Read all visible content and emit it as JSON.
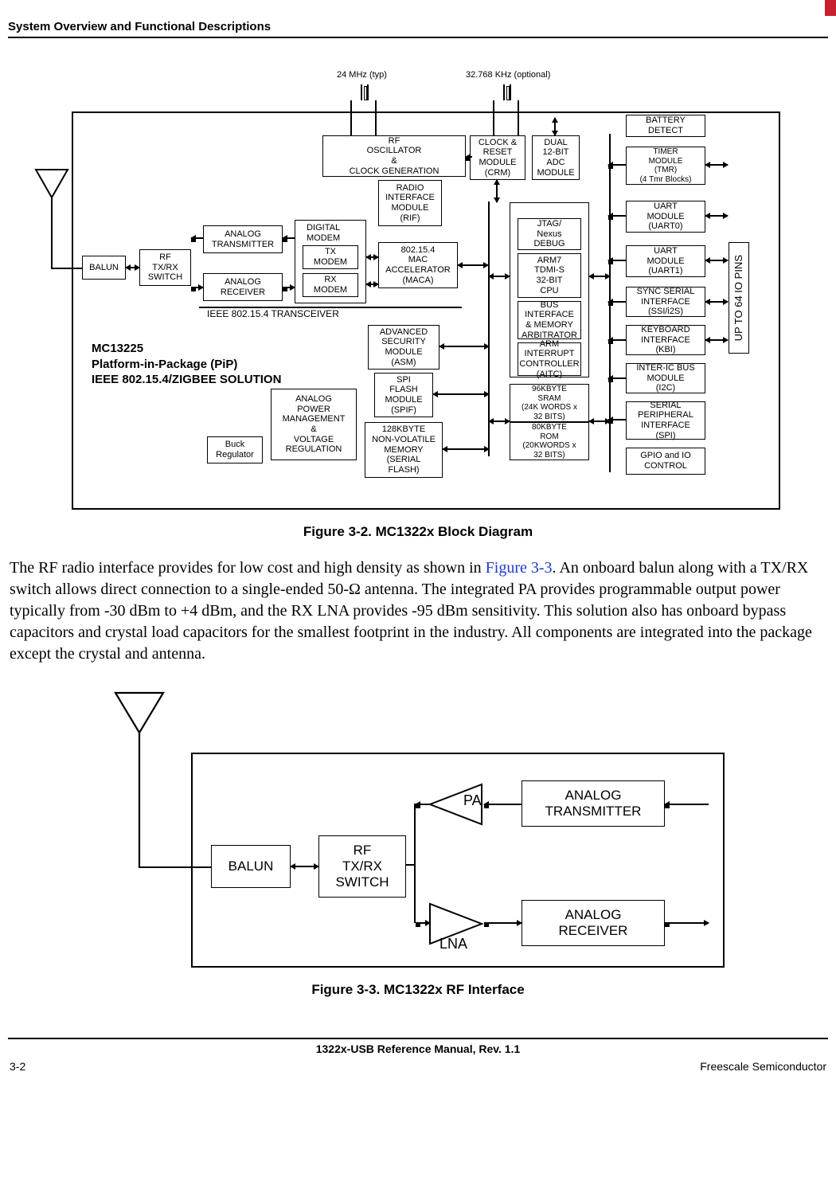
{
  "header": {
    "section_title": "System Overview and Functional Descriptions"
  },
  "fig1": {
    "clk24": "24 MHz (typ)",
    "clk32": "32.768 KHz (optional)",
    "rf_osc": "RF\nOSCILLATOR\n&\nCLOCK GENERATION",
    "rif": "RADIO\nINTERFACE\nMODULE\n(RIF)",
    "digital_modem": "DIGITAL\nMODEM",
    "tx_modem": "TX\nMODEM",
    "rx_modem": "RX\nMODEM",
    "maca": "802.15.4\nMAC\nACCELERATOR\n(MACA)",
    "analog_tx": "ANALOG\nTRANSMITTER",
    "analog_rx": "ANALOG\nRECEIVER",
    "balun": "BALUN",
    "rf_sw": "RF\nTX/RX\nSWITCH",
    "transceiver": "IEEE 802.15.4 TRANSCEIVER",
    "asm": "ADVANCED\nSECURITY\nMODULE\n(ASM)",
    "spif": "SPI\nFLASH\nMODULE\n(SPIF)",
    "flash": "128KBYTE\nNON-VOLATILE\nMEMORY\n(SERIAL\nFLASH)",
    "apm": "ANALOG\nPOWER\nMANAGEMENT\n&\nVOLTAGE\nREGULATION",
    "buck": "Buck\nRegulator",
    "crm": "CLOCK &\nRESET\nMODULE\n(CRM)",
    "adc": "DUAL\n12-BIT\nADC\nMODULE",
    "jtag": "JTAG/\nNexus\nDEBUG",
    "arm7": "ARM7\nTDMI-S\n32-BIT\nCPU",
    "bus": "BUS\nINTERFACE\n& MEMORY\nARBITRATOR",
    "aitc": "ARM\nINTERRUPT\nCONTROLLER\n(AITC)",
    "sram": "96KBYTE\nSRAM\n(24K WORDS x\n32 BITS)",
    "rom": "80KBYTE\nROM\n(20KWORDS x\n32 BITS)",
    "batt": "BATTERY\nDETECT",
    "tmr": "TIMER\nMODULE\n(TMR)\n(4 Tmr Blocks)",
    "uart0": "UART\nMODULE\n(UART0)",
    "uart1": "UART\nMODULE\n(UART1)",
    "ssi": "SYNC SERIAL\nINTERFACE\n(SSI/i2S)",
    "kbi": "KEYBOARD\nINTERFACE\n(KBI)",
    "i2c": "INTER-IC BUS\nMODULE\n(I2C)",
    "spi": "SERIAL\nPERIPHERAL\nINTERFACE\n(SPI)",
    "gpio": "GPIO and IO\nCONTROL",
    "iopins": "UP TO 64 IO PINS",
    "chip_label": "MC13225\nPlatform-in-Package (PiP)\nIEEE 802.15.4/ZIGBEE SOLUTION",
    "caption": "Figure 3-2. MC1322x Block Diagram"
  },
  "paragraph": {
    "pre": "The RF radio interface provides for low cost and high density as shown in ",
    "link": "Figure 3-3",
    "post": ". An onboard balun along with a TX/RX switch allows direct connection to a single-ended 50-Ω antenna. The integrated PA provides programmable output power typically from -30 dBm to +4 dBm, and the RX LNA provides -95 dBm sensitivity. This solution also has onboard bypass capacitors and crystal load capacitors for the smallest footprint in the industry. All components are integrated into the package except the crystal and antenna."
  },
  "fig2": {
    "balun": "BALUN",
    "rf_sw": "RF\nTX/RX\nSWITCH",
    "pa": "PA",
    "lna": "LNA",
    "analog_tx": "ANALOG\nTRANSMITTER",
    "analog_rx": "ANALOG\nRECEIVER",
    "caption": "Figure 3-3. MC1322x RF Interface"
  },
  "footer": {
    "manual": "1322x-USB Reference Manual, Rev. 1.1",
    "page": "3-2",
    "vendor": "Freescale Semiconductor"
  }
}
